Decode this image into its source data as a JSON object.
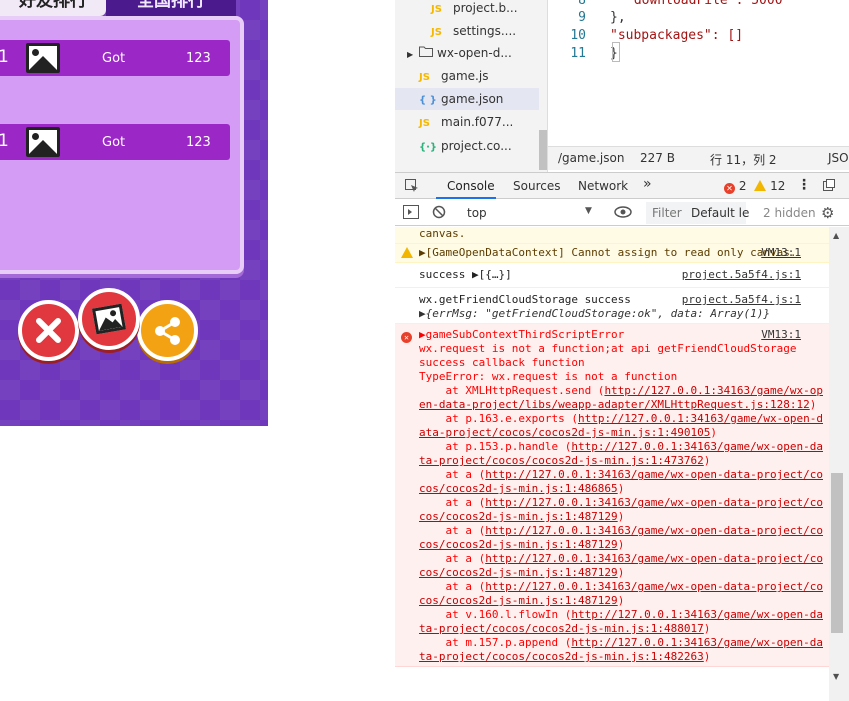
{
  "game": {
    "tabs": {
      "friends": "好友排行",
      "global": "全国排行"
    },
    "rows": [
      {
        "rank": "1",
        "name": "Got",
        "score": "123"
      },
      {
        "rank": "1",
        "name": "Got",
        "score": "123"
      }
    ],
    "buttons": [
      "close-icon",
      "photo-icon",
      "share-icon"
    ]
  },
  "file_tree": {
    "items": [
      {
        "label": "project.b...",
        "icon": "JS"
      },
      {
        "label": "settings....",
        "icon": "JS"
      },
      {
        "label": "wx-open-d...",
        "icon": "folder"
      },
      {
        "label": "game.js",
        "icon": "JS"
      },
      {
        "label": "game.json",
        "icon": "{ }"
      },
      {
        "label": "main.f077...",
        "icon": "JS"
      },
      {
        "label": "project.co...",
        "icon": "{·}"
      }
    ]
  },
  "editor": {
    "lines": [
      {
        "n": "8",
        "text": "\"downloadFile\": 5000"
      },
      {
        "n": "9",
        "text": "},"
      },
      {
        "n": "10",
        "text": "\"subpackages\": []"
      },
      {
        "n": "11",
        "text": "}"
      }
    ],
    "status": {
      "file": "/game.json",
      "size": "227 B",
      "pos": "行 11，列 2",
      "lang": "JSO"
    }
  },
  "devtools": {
    "tabs": [
      "Console",
      "Sources",
      "Network"
    ],
    "more": "»",
    "error_count": "2",
    "warn_count": "12",
    "context": "top",
    "filter_placeholder": "Filter",
    "levels": "Default le",
    "hidden": "2 hidden",
    "messages": [
      {
        "type": "warn",
        "text": "canvas.",
        "src": ""
      },
      {
        "type": "warn",
        "text": "▶[GameOpenDataContext] Cannot assign to read only canvas.",
        "src": "VM13:1"
      },
      {
        "type": "info",
        "text": "success ▶[{…}]",
        "src": "project.5a5f4.js:1"
      },
      {
        "type": "info",
        "text": "wx.getFriendCloudStorage success",
        "src": "project.5a5f4.js:1"
      },
      {
        "type": "info",
        "text": "▶{errMsg: \"getFriendCloudStorage:ok\", data: Array(1)}",
        "src": ""
      }
    ],
    "error": {
      "src": "VM13:1",
      "title": "▶gameSubContextThirdScriptError",
      "lines": [
        "wx.request is not a function;at api getFriendCloudStorage",
        "success callback function",
        "TypeError: wx.request is not a function"
      ],
      "stack": [
        {
          "fn": "at XMLHttpRequest.send",
          "url": "http://127.0.0.1:34163/game/wx-open-data-project/libs/weapp-adapter/XMLHttpRequest.js:128:12"
        },
        {
          "fn": "at p.163.e.exports",
          "url": "http://127.0.0.1:34163/game/wx-open-data-project/cocos/cocos2d-js-min.js:1:490105"
        },
        {
          "fn": "at p.153.p.handle",
          "url": "http://127.0.0.1:34163/game/wx-open-data-project/cocos/cocos2d-js-min.js:1:473762"
        },
        {
          "fn": "at a",
          "url": "http://127.0.0.1:34163/game/wx-open-data-project/cocos/cocos2d-js-min.js:1:486865"
        },
        {
          "fn": "at a",
          "url": "http://127.0.0.1:34163/game/wx-open-data-project/cocos/cocos2d-js-min.js:1:487129"
        },
        {
          "fn": "at a",
          "url": "http://127.0.0.1:34163/game/wx-open-data-project/cocos/cocos2d-js-min.js:1:487129"
        },
        {
          "fn": "at a",
          "url": "http://127.0.0.1:34163/game/wx-open-data-project/cocos/cocos2d-js-min.js:1:487129"
        },
        {
          "fn": "at a",
          "url": "http://127.0.0.1:34163/game/wx-open-data-project/cocos/cocos2d-js-min.js:1:487129"
        },
        {
          "fn": "at v.160.l.flowIn",
          "url": "http://127.0.0.1:34163/game/wx-open-data-project/cocos/cocos2d-js-min.js:1:488017"
        },
        {
          "fn": "at m.157.p.append",
          "url": "http://127.0.0.1:34163/game/wx-open-data-project/cocos/cocos2d-js-min.js:1:482263"
        }
      ]
    }
  }
}
